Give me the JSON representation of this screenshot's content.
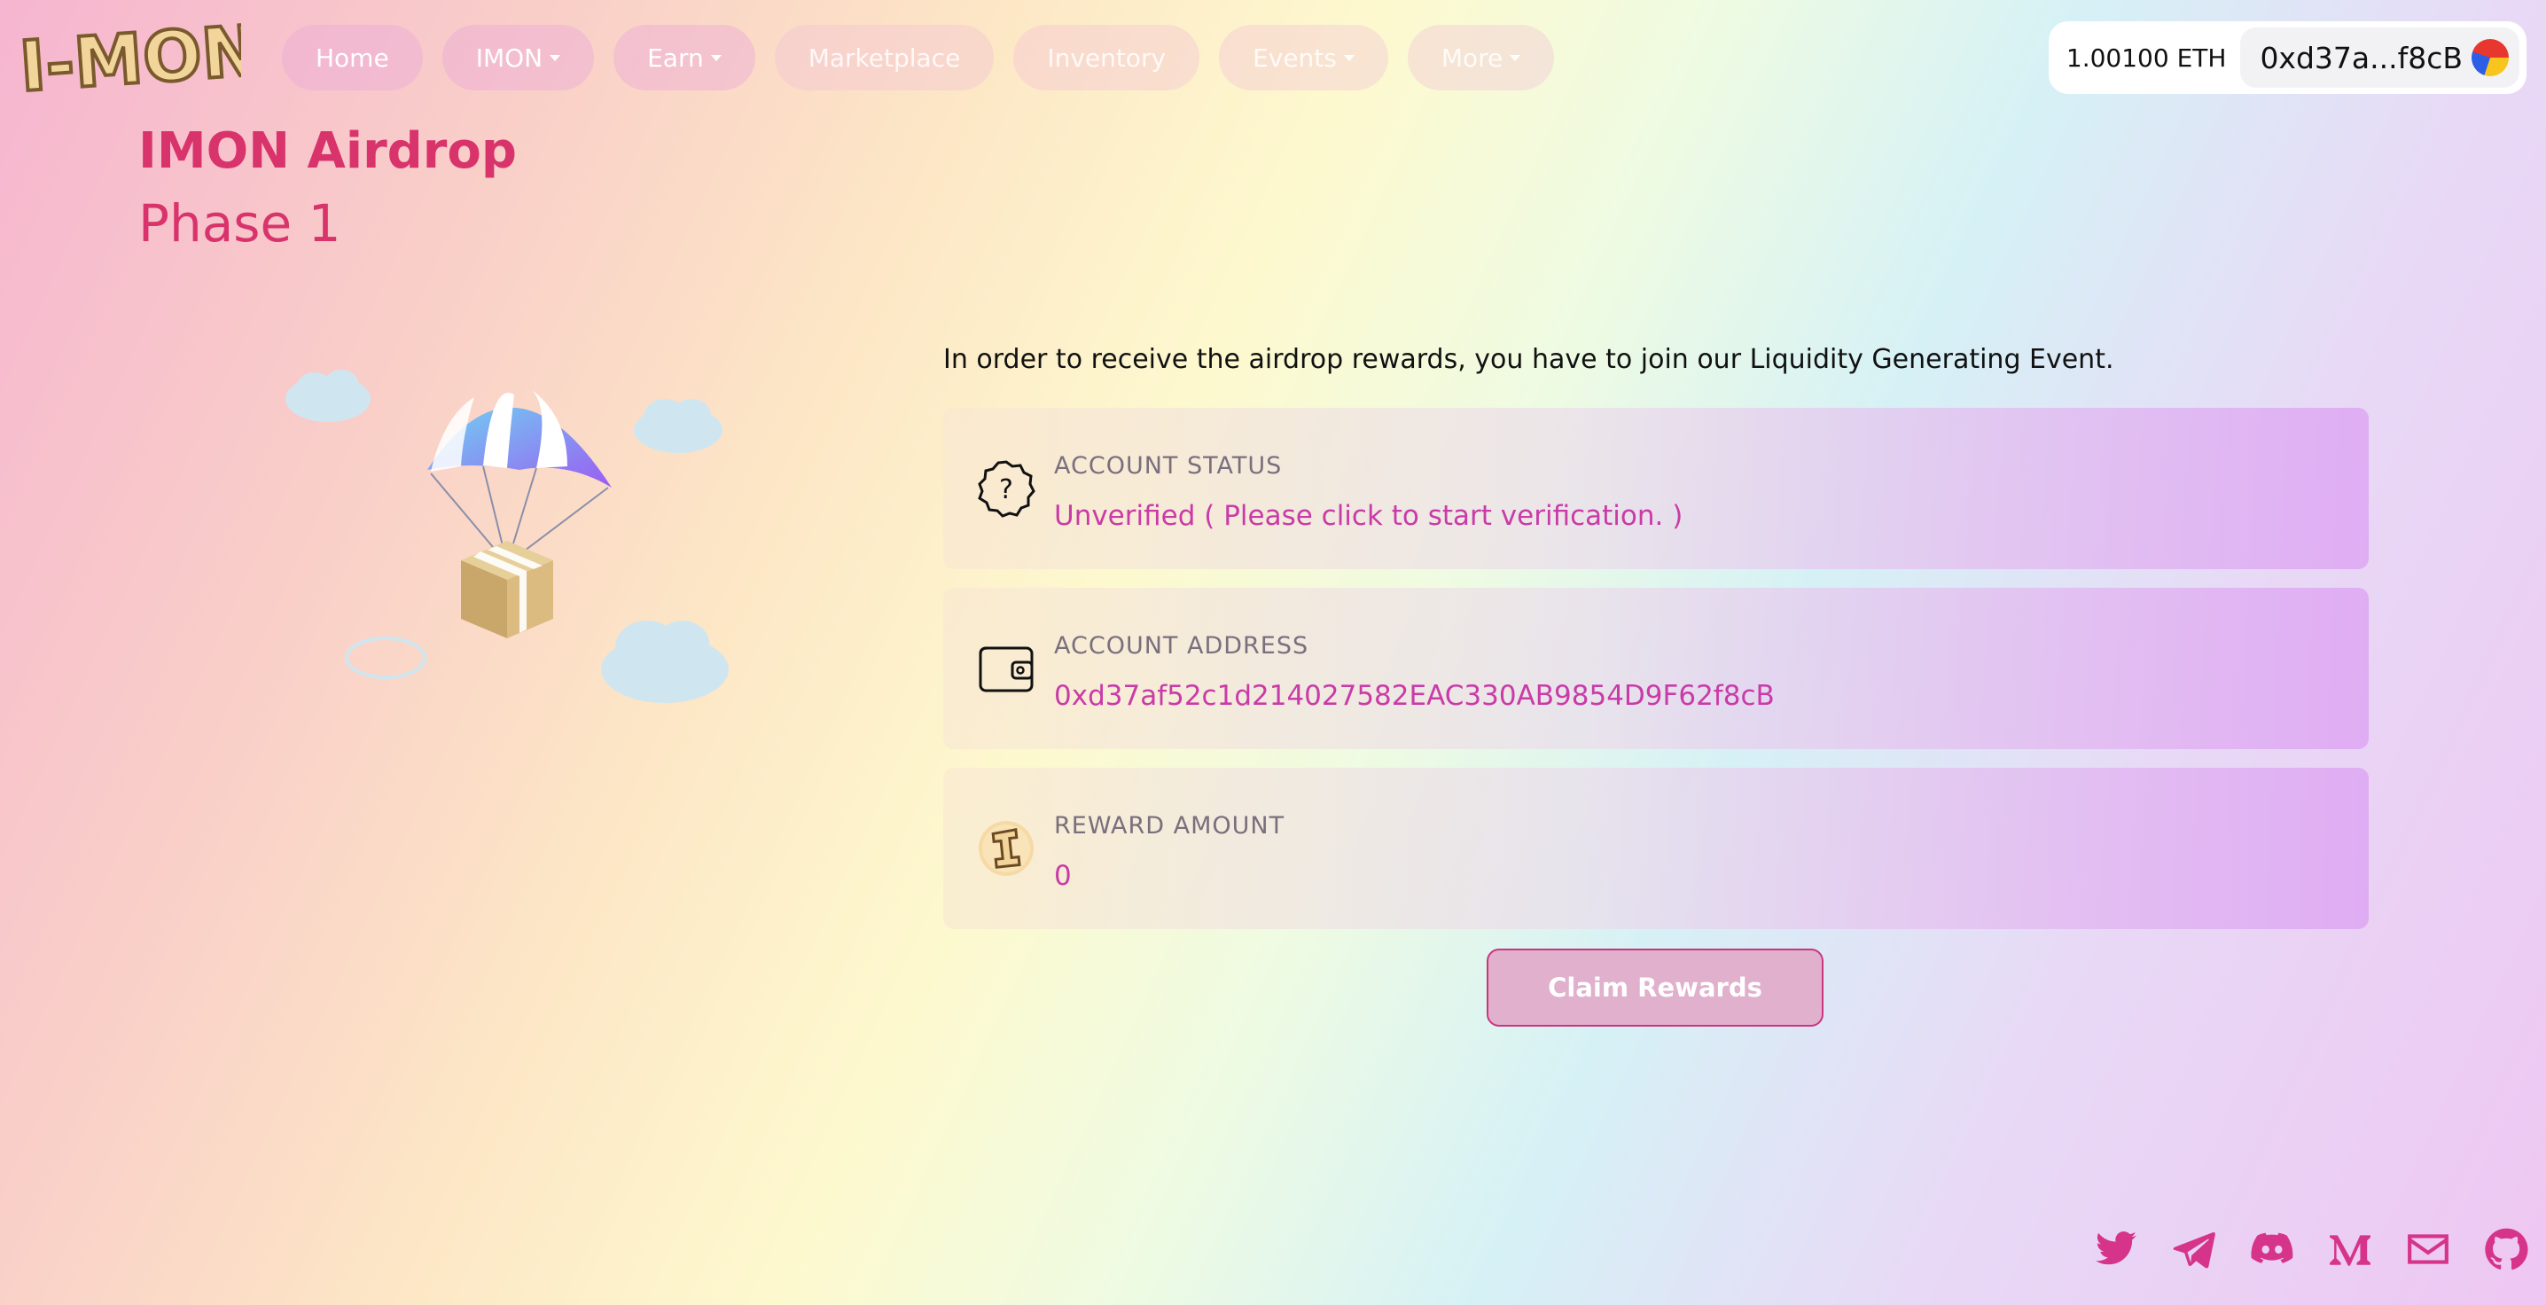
{
  "header": {
    "logo_text": "I-MON",
    "nav": [
      {
        "label": "Home",
        "dropdown": false
      },
      {
        "label": "IMON",
        "dropdown": true
      },
      {
        "label": "Earn",
        "dropdown": true
      },
      {
        "label": "Marketplace",
        "dropdown": false
      },
      {
        "label": "Inventory",
        "dropdown": false
      },
      {
        "label": "Events",
        "dropdown": true
      },
      {
        "label": "More",
        "dropdown": true
      }
    ],
    "wallet": {
      "balance": "1.00100 ETH",
      "address": "0xd37a...f8cB"
    }
  },
  "page": {
    "title": "IMON Airdrop",
    "subtitle": "Phase 1"
  },
  "main": {
    "intro": "In order to receive the airdrop rewards, you have to join our Liquidity Generating Event.",
    "cards": [
      {
        "label": "ACCOUNT STATUS",
        "value": "Unverified ( Please click to start verification. )",
        "icon": "question-badge-icon"
      },
      {
        "label": "ACCOUNT ADDRESS",
        "value": "0xd37af52c1d214027582EAC330AB9854D9F62f8cB",
        "icon": "wallet-icon"
      },
      {
        "label": "REWARD AMOUNT",
        "value": "0",
        "icon": "imon-coin-icon"
      }
    ],
    "claim_label": "Claim Rewards"
  },
  "footer": {
    "socials": [
      "twitter-icon",
      "telegram-icon",
      "discord-icon",
      "medium-icon",
      "email-icon",
      "github-icon"
    ]
  },
  "colors": {
    "accent": "#d9336c",
    "value": "#c93ba7",
    "social": "#d6338a"
  }
}
